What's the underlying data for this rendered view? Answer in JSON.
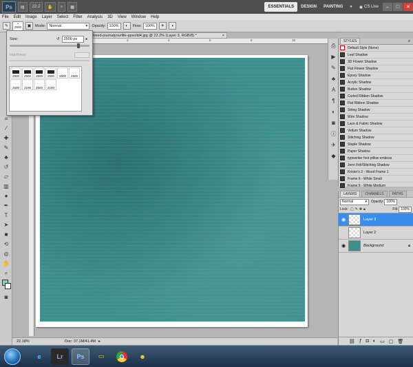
{
  "app": {
    "logo": "Ps",
    "zoom": "22.2",
    "workspaces": {
      "essentials": "ESSENTIALS",
      "design": "DESIGN",
      "painting": "PAINTING",
      "more": "»"
    },
    "cslive": "CS Live"
  },
  "menu": [
    "File",
    "Edit",
    "Image",
    "Layer",
    "Select",
    "Filter",
    "Analysis",
    "3D",
    "View",
    "Window",
    "Help"
  ],
  "options": {
    "brush_size": "2500",
    "mode_label": "Mode:",
    "mode_value": "Normal",
    "opacity_label": "Opacity:",
    "opacity_value": "100%",
    "flow_label": "Flow:",
    "flow_value": "100%"
  },
  "brush_panel": {
    "size_label": "Size:",
    "size_value": "2500 px",
    "hardness_label": "Hardness:",
    "presets": [
      "2500",
      "2500",
      "2500",
      "2500",
      "2500",
      "2500",
      "2500",
      "2195",
      "2500",
      "2160"
    ]
  },
  "document": {
    "tab_title": "treed-journalyourlife-ppsolid4.jpg @ 22.2% (Layer 3, RGB/8) *",
    "rulers_top": [
      "2",
      "4",
      "6",
      "8",
      "10",
      "12"
    ]
  },
  "status": {
    "zoom": "22.18%",
    "doc_label": "Doc: 37.1M/41.4M"
  },
  "styles_panel": {
    "tab": "STYLES",
    "items": [
      "Default Style (None)",
      "Leaf Shadow",
      "3D Flower Shadow",
      "Flat Flower Shadow",
      "Epoxy Shadow",
      "Acrylic Shadow",
      "Button Shadow",
      "Curled Ribbon Shadow",
      "Flat Ribbon Shadow",
      "String Shadow",
      "Wire Shadow",
      "Lace & Fabric Shadow",
      "Vellum Shadow",
      "Stitching Shadow",
      "Staple Shadow",
      "Paper Shadow",
      "typewriter font pillow emboss",
      "Jenn Felt/Stitching Shadow",
      "Krister's 2 - Wood Frame 1",
      "Frame It - White Small",
      "Frame It - White Medium"
    ]
  },
  "layers_panel": {
    "tabs": [
      "LAYERS",
      "CHANNELS",
      "PATHS"
    ],
    "blend_mode": "Normal",
    "opacity_label": "Opacity:",
    "opacity_value": "100%",
    "lock_label": "Lock:",
    "fill_label": "Fill:",
    "fill_value": "100%",
    "layers": [
      {
        "name": "Layer 3",
        "selected": true
      },
      {
        "name": "Layer 2",
        "selected": false
      },
      {
        "name": "Background",
        "selected": false
      }
    ]
  },
  "taskbar": {
    "apps": [
      "ie-icon",
      "Lr",
      "Ps",
      "folder-icon",
      "chrome-icon",
      "messenger-icon"
    ]
  }
}
